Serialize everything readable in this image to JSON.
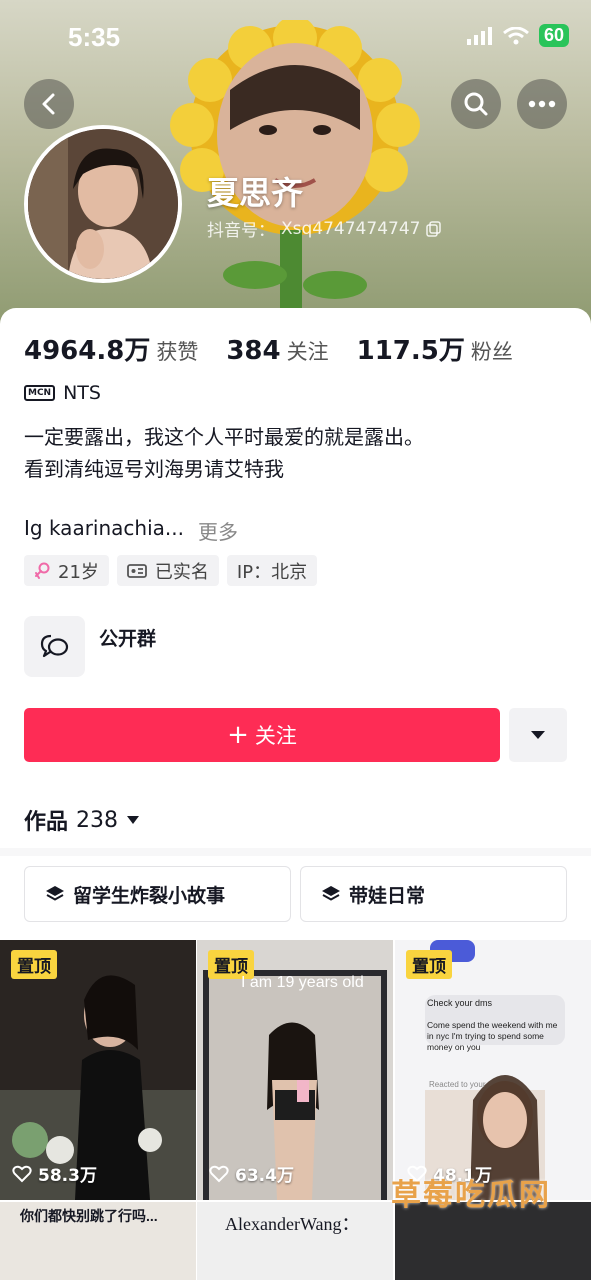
{
  "status_bar": {
    "time": "5:35",
    "battery": "60"
  },
  "profile": {
    "nickname": "夏思齐",
    "douyin_id_label": "抖音号：",
    "douyin_id": "Xsq4747474747"
  },
  "stats": [
    {
      "value": "4964.8万",
      "label": "获赞"
    },
    {
      "value": "384",
      "label": "关注"
    },
    {
      "value": "117.5万",
      "label": "粉丝"
    }
  ],
  "mcn": {
    "badge": "MCN",
    "name": "NTS"
  },
  "bio": {
    "line1": "一定要露出，我这个人平时最爱的就是露出。",
    "line2": "看到清纯逗号刘海男请艾特我",
    "line3": "Ig kaarinachia...",
    "more": "更多"
  },
  "tags": [
    {
      "icon": "female-icon",
      "text": "21岁"
    },
    {
      "icon": "id-card-icon",
      "text": "已实名"
    },
    {
      "icon": "",
      "text": "IP：北京"
    }
  ],
  "group": {
    "name": "公开群"
  },
  "follow_button": {
    "icon": "+",
    "label": "关注"
  },
  "works": {
    "label": "作品",
    "count": "238"
  },
  "collections": [
    {
      "label": "留学生炸裂小故事"
    },
    {
      "label": "带娃日常"
    }
  ],
  "videos": [
    {
      "pinned": "置顶",
      "likes": "58.3万"
    },
    {
      "pinned": "置顶",
      "likes": "63.4万",
      "overlay": "I am 19 years old"
    },
    {
      "pinned": "置顶",
      "likes": "48.1万",
      "chat1": "Check your dms",
      "chat2": "Come spend the weekend with me in nyc I'm trying to spend some money on you",
      "chat3": "Reacted to your"
    }
  ],
  "second_row": {
    "cell1_text": "你们都快别跳了行吗...",
    "cell2_text": "AlexanderWang："
  },
  "watermark": "草莓吃瓜网",
  "colors": {
    "accent": "#fe2c55",
    "pin": "#f9d43f",
    "battery": "#29c45a"
  }
}
